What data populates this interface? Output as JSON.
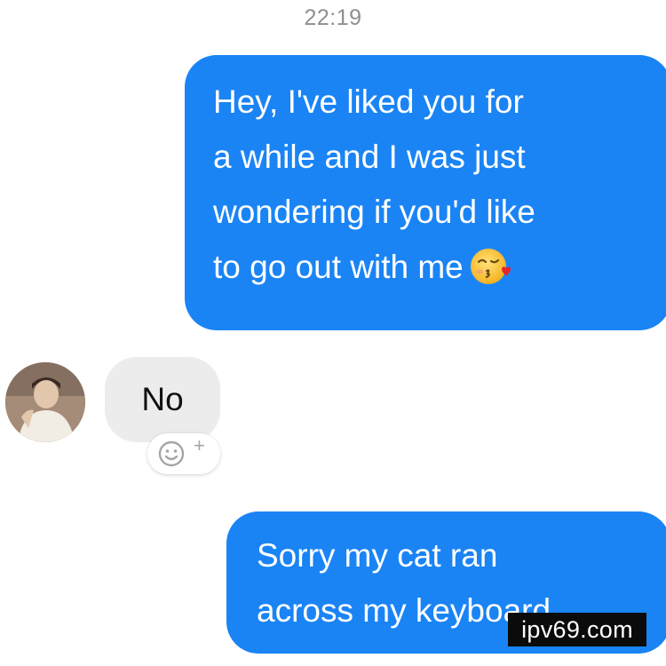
{
  "conversation": {
    "timestamp": "22:19",
    "messages": [
      {
        "direction": "outgoing",
        "lines": [
          "Hey, I've liked you for",
          "a while and I was just",
          "wondering if you'd like",
          "to go out with me"
        ],
        "emoji": "kissing-face-emoji"
      },
      {
        "direction": "incoming",
        "text": "No",
        "reaction_control": "add-reaction-icon"
      },
      {
        "direction": "outgoing",
        "lines": [
          "Sorry my cat ran",
          "across my keyboard"
        ]
      }
    ]
  },
  "watermark": "ipv69.com",
  "colors": {
    "outgoing_bubble": "#1a84f5",
    "incoming_bubble": "#ececec",
    "timestamp": "#8e8e93"
  }
}
